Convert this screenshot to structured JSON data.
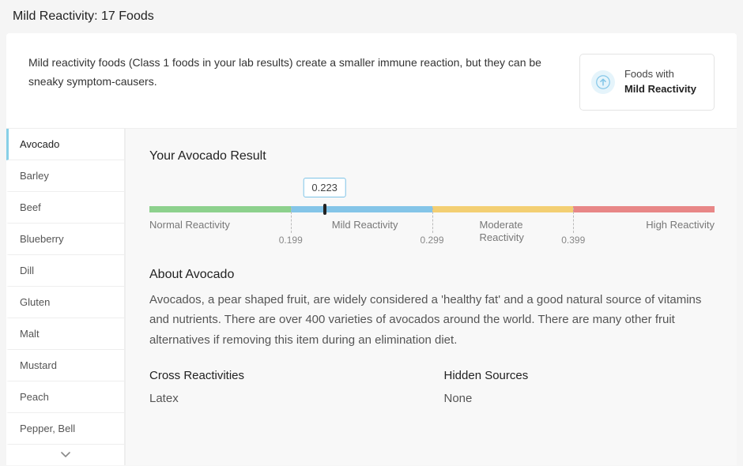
{
  "header": {
    "title": "Mild Reactivity: 17 Foods"
  },
  "intro": {
    "text": "Mild reactivity foods (Class 1 foods in your lab results) create a smaller immune reaction, but they can be sneaky symptom-causers.",
    "badge_line1": "Foods with",
    "badge_line2": "Mild Reactivity"
  },
  "sidebar": {
    "items": [
      {
        "label": "Avocado",
        "active": true
      },
      {
        "label": "Barley",
        "active": false
      },
      {
        "label": "Beef",
        "active": false
      },
      {
        "label": "Blueberry",
        "active": false
      },
      {
        "label": "Dill",
        "active": false
      },
      {
        "label": "Gluten",
        "active": false
      },
      {
        "label": "Malt",
        "active": false
      },
      {
        "label": "Mustard",
        "active": false
      },
      {
        "label": "Peach",
        "active": false
      },
      {
        "label": "Pepper, Bell",
        "active": false
      }
    ]
  },
  "result": {
    "title": "Your Avocado Result",
    "value": 0.223,
    "value_display": "0.223",
    "thresholds": {
      "mild": 0.199,
      "moderate": 0.299,
      "high": 0.399
    },
    "threshold_labels": {
      "mild": "0.199",
      "moderate": "0.299",
      "high": "0.399"
    },
    "zones": {
      "normal": "Normal Reactivity",
      "mild": "Mild Reactivity",
      "moderate": "Moderate Reactivity",
      "high": "High Reactivity"
    }
  },
  "about": {
    "title": "About Avocado",
    "text": "Avocados, a pear shaped fruit, are widely considered a 'healthy fat' and a good natural source of vitamins and nutrients. There are over 400 varieties of avocados around the world. There are many other fruit alternatives if removing this item during an elimination diet."
  },
  "cross": {
    "title": "Cross Reactivities",
    "value": "Latex"
  },
  "hidden": {
    "title": "Hidden Sources",
    "value": "None"
  },
  "chart_data": {
    "type": "bar",
    "orientation": "horizontal-scale",
    "title": "Your Avocado Result",
    "value": 0.223,
    "zones": [
      {
        "name": "Normal Reactivity",
        "color": "#8dd18d",
        "range": [
          0,
          0.199
        ]
      },
      {
        "name": "Mild Reactivity",
        "color": "#84c5e8",
        "range": [
          0.199,
          0.299
        ]
      },
      {
        "name": "Moderate Reactivity",
        "color": "#f3cf73",
        "range": [
          0.299,
          0.399
        ]
      },
      {
        "name": "High Reactivity",
        "color": "#e88787",
        "range": [
          0.399,
          null
        ]
      }
    ],
    "ticks": [
      0.199,
      0.299,
      0.399
    ]
  }
}
